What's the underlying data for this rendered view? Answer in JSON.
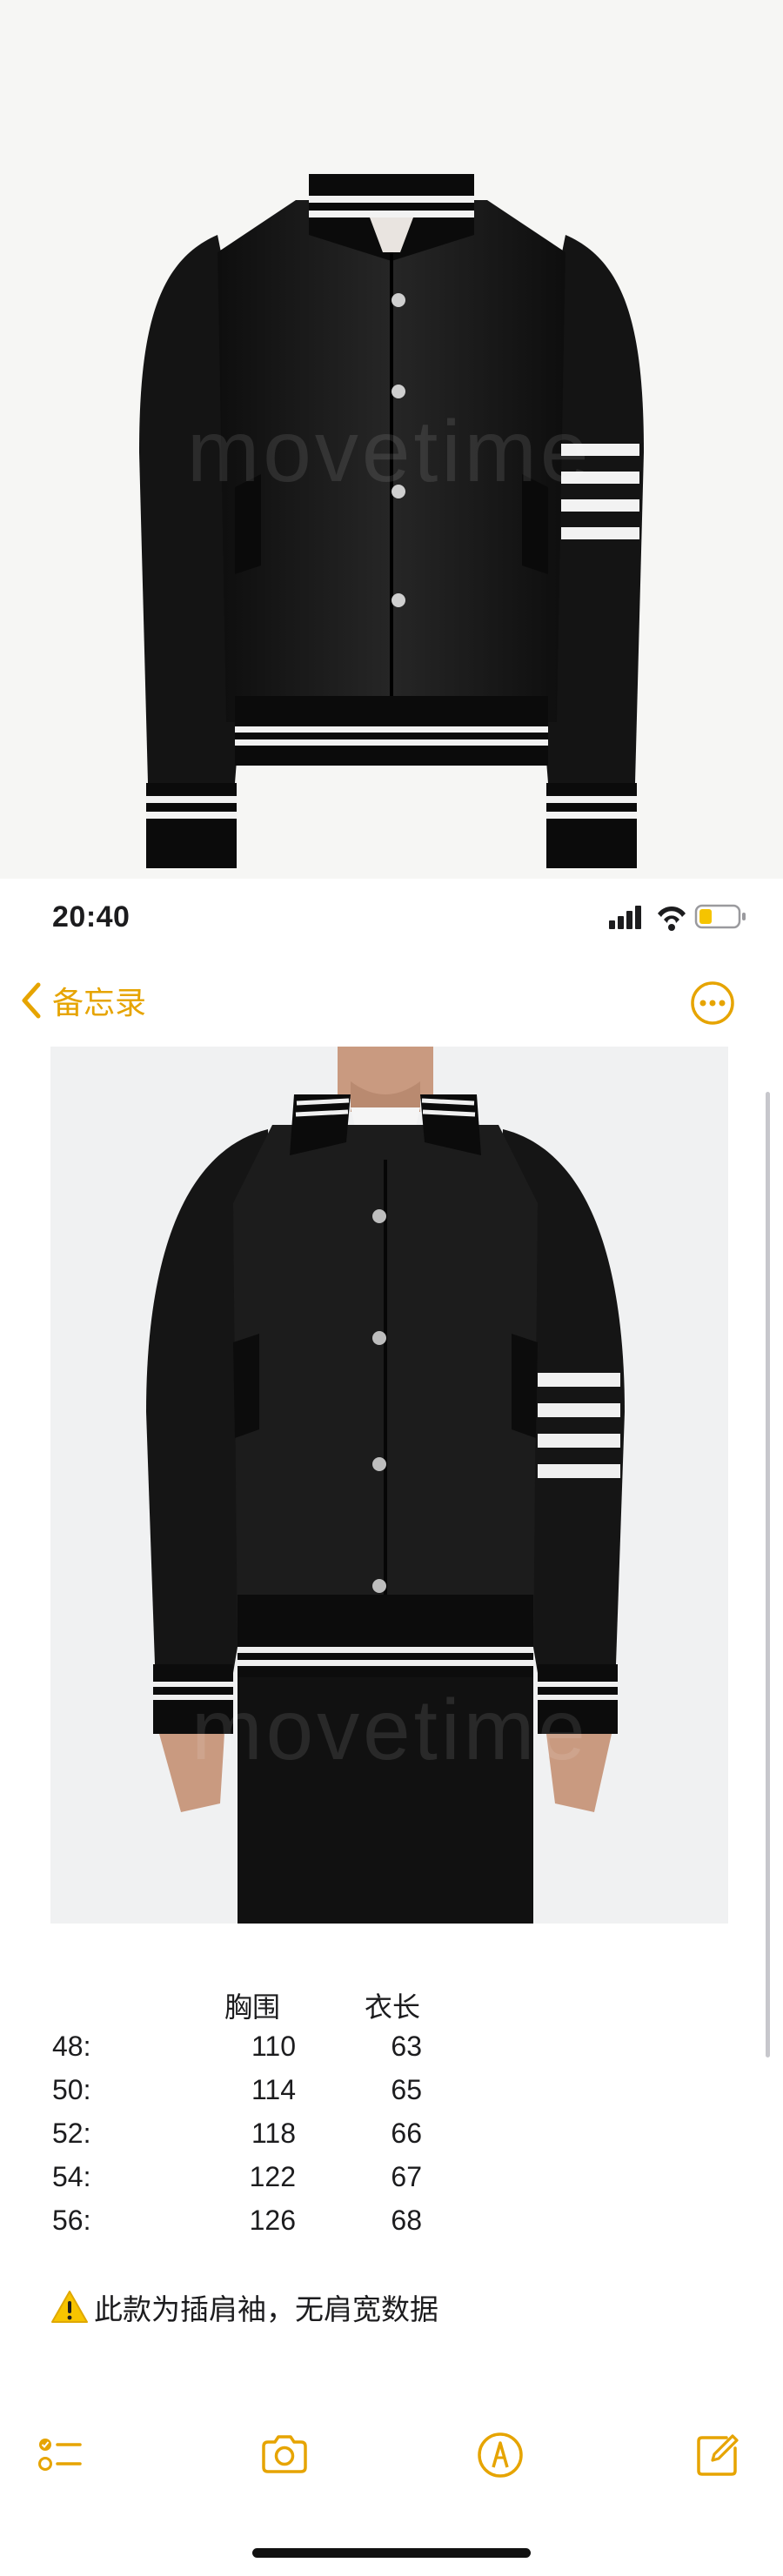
{
  "status_bar": {
    "time": "20:40"
  },
  "nav": {
    "back_label": "备忘录"
  },
  "watermark": {
    "text": "movetime"
  },
  "size_table": {
    "headers": [
      "胸围",
      "衣长"
    ],
    "rows": [
      {
        "size": "48:",
        "chest": "110",
        "length": "63"
      },
      {
        "size": "50:",
        "chest": "114",
        "length": "65"
      },
      {
        "size": "52:",
        "chest": "118",
        "length": "66"
      },
      {
        "size": "54:",
        "chest": "122",
        "length": "67"
      },
      {
        "size": "56:",
        "chest": "126",
        "length": "68"
      }
    ]
  },
  "note": {
    "warning_text": "此款为插肩袖，无肩宽数据"
  },
  "colors": {
    "accent": "#e6a400",
    "jacket": "#161616",
    "stripe": "#f2f2f2"
  },
  "toolbar": {
    "icons": [
      "checklist-icon",
      "camera-icon",
      "markup-icon",
      "compose-icon"
    ]
  }
}
